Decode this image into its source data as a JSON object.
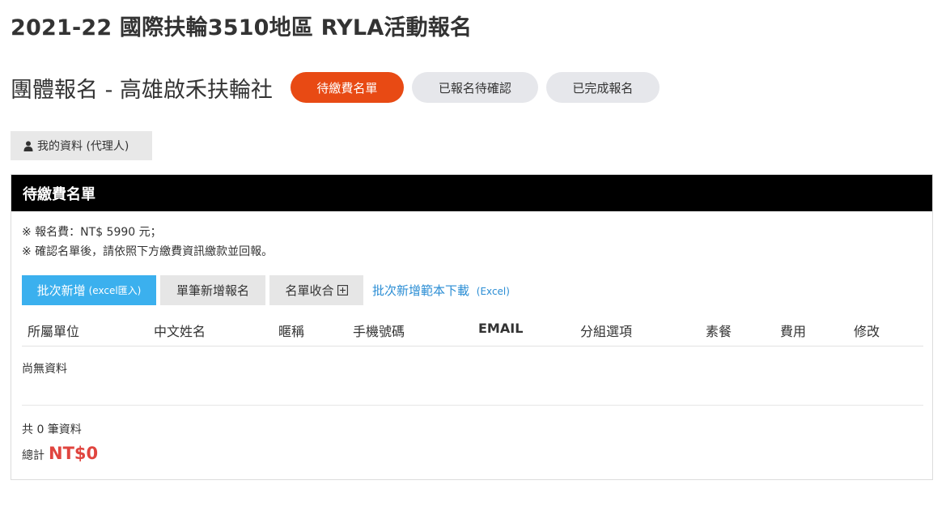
{
  "page": {
    "title": "2021-22 國際扶輪3510地區 RYLA活動報名"
  },
  "header": {
    "group_title": "團體報名 - 高雄啟禾扶輪社",
    "tabs": [
      {
        "label": "待繳費名單",
        "active": true
      },
      {
        "label": "已報名待確認",
        "active": false
      },
      {
        "label": "已完成報名",
        "active": false
      }
    ]
  },
  "profile": {
    "icon": "user-icon",
    "label": "我的資料 (代理人)"
  },
  "panel": {
    "title": "待繳費名單",
    "notes": [
      "※ 報名費：NT$ 5990 元；",
      "※ 確認名單後，請依照下方繳費資訊繳款並回報。"
    ],
    "toolbar": {
      "batch_add_label": "批次新增",
      "batch_add_sub": "(excel匯入)",
      "single_add_label": "單筆新增報名",
      "collapse_label": "名單收合",
      "collapse_icon": "plus-square-icon",
      "template_link_label": "批次新增範本下載",
      "template_link_sub": "(Excel)"
    },
    "table": {
      "columns": [
        "所屬單位",
        "中文姓名",
        "暱稱",
        "手機號碼",
        "EMAIL",
        "分組選項",
        "素餐",
        "費用",
        "修改"
      ],
      "rows": [],
      "empty_text": "尚無資料"
    },
    "count_text": "共 0 筆資料",
    "total_label": "總計",
    "total_value": "NT$0"
  },
  "colors": {
    "accent": "#e84a14",
    "primary_button": "#3bb0ee",
    "link": "#2a8dd4",
    "total": "#e0453f",
    "panel_header": "#000000"
  }
}
